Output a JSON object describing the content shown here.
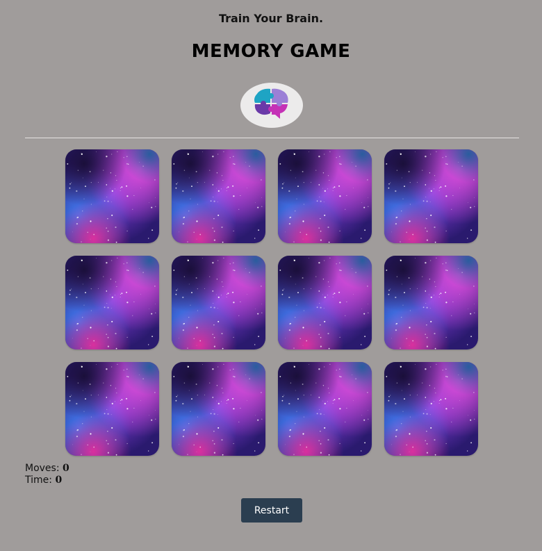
{
  "header": {
    "tagline": "Train Your Brain.",
    "title": "MEMORY GAME",
    "logo_icon": "brain-puzzle-icon"
  },
  "board": {
    "rows": 3,
    "columns": 4,
    "cards": [
      {
        "state": "face-down"
      },
      {
        "state": "face-down"
      },
      {
        "state": "face-down"
      },
      {
        "state": "face-down"
      },
      {
        "state": "face-down"
      },
      {
        "state": "face-down"
      },
      {
        "state": "face-down"
      },
      {
        "state": "face-down"
      },
      {
        "state": "face-down"
      },
      {
        "state": "face-down"
      },
      {
        "state": "face-down"
      },
      {
        "state": "face-down"
      }
    ],
    "card_back": "galaxy-nebula-pattern"
  },
  "stats": {
    "moves_label": "Moves:",
    "moves_value": "0",
    "time_label": "Time:",
    "time_value": "0"
  },
  "controls": {
    "restart_label": "Restart"
  },
  "colors": {
    "background": "#a09c9b",
    "button": "#2b3e50",
    "nebula_purple": "#7a2fc0",
    "nebula_magenta": "#d43ad6",
    "nebula_blue": "#3a5be0"
  }
}
